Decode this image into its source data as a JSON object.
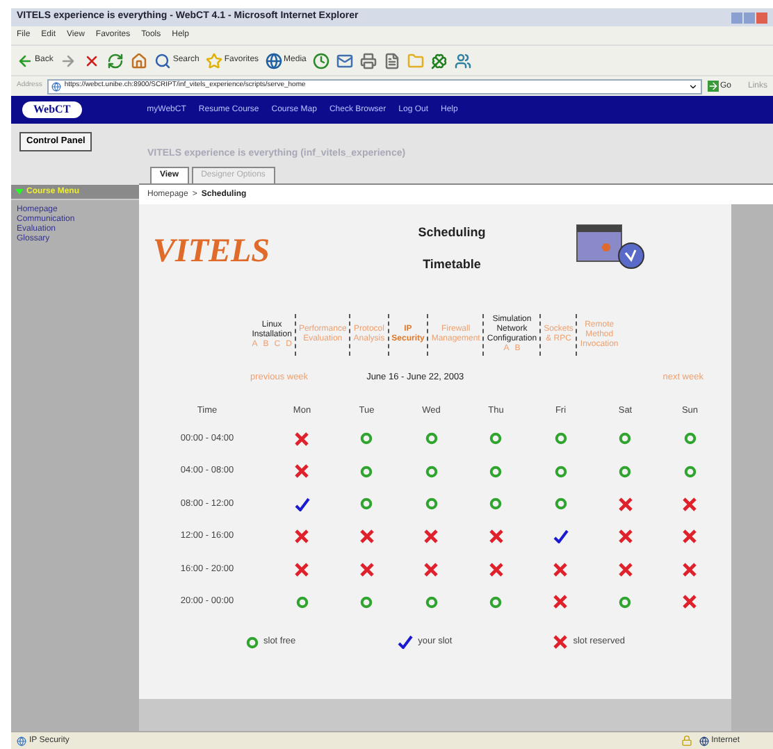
{
  "window": {
    "title": "VITELS experience is everything - WebCT 4.1 - Microsoft Internet Explorer"
  },
  "menu": [
    "File",
    "Edit",
    "View",
    "Favorites",
    "Tools",
    "Help"
  ],
  "toolbar": [
    {
      "kind": "back",
      "label": "Back"
    },
    {
      "kind": "forward"
    },
    {
      "kind": "stop"
    },
    {
      "kind": "refresh"
    },
    {
      "kind": "home"
    },
    {
      "kind": "search",
      "label": "Search"
    },
    {
      "kind": "favorites",
      "label": "Favorites"
    },
    {
      "kind": "media",
      "label": "Media"
    },
    {
      "kind": "history"
    },
    {
      "kind": "mail"
    },
    {
      "kind": "print"
    },
    {
      "kind": "edit"
    },
    {
      "kind": "folder"
    },
    {
      "kind": "clover"
    },
    {
      "kind": "messenger"
    }
  ],
  "address": {
    "label": "Address",
    "url": "https://webct.unibe.ch:8900/SCRIPT/inf_vitels_experience/scripts/serve_home",
    "go": "Go",
    "links": "Links"
  },
  "webct": {
    "logo": "WebCT",
    "links": [
      "myWebCT",
      "Resume Course",
      "Course Map",
      "Check Browser",
      "Log Out",
      "Help"
    ]
  },
  "control_panel": "Control Panel",
  "course_title": "VITELS experience is everything  (inf_vitels_experience)",
  "tabs": [
    {
      "label": "View",
      "selected": true
    },
    {
      "label": "Designer Options",
      "selected": false
    }
  ],
  "sidebar": {
    "heading": "Course Menu",
    "expanded": true,
    "items": [
      "Homepage",
      "Communication",
      "Evaluation",
      "Glossary"
    ]
  },
  "breadcrumb": {
    "parent": "Homepage",
    "separator": ">",
    "current": "Scheduling"
  },
  "logo_text": "VITELS",
  "heading": "Scheduling",
  "subheading": "Timetable",
  "modules": [
    {
      "lines": [
        "Linux",
        "Installation"
      ],
      "kind": "plain",
      "selected": false,
      "parts": [
        "A",
        "B",
        "C",
        "D"
      ]
    },
    {
      "lines": [
        "Performance",
        "Evaluation"
      ],
      "kind": "link",
      "selected": false
    },
    {
      "lines": [
        "Protocol",
        "Analysis"
      ],
      "kind": "link",
      "selected": false
    },
    {
      "lines": [
        "IP",
        "Security"
      ],
      "kind": "link",
      "selected": true
    },
    {
      "lines": [
        "Firewall",
        "Management"
      ],
      "kind": "link",
      "selected": false
    },
    {
      "lines": [
        "Simulation",
        "Network",
        "Configuration"
      ],
      "kind": "plain",
      "selected": false,
      "parts": [
        "A",
        "B"
      ]
    },
    {
      "lines": [
        "Sockets",
        "& RPC"
      ],
      "kind": "link",
      "selected": false
    },
    {
      "lines": [
        "Remote",
        "Method",
        "Invocation"
      ],
      "kind": "link",
      "selected": false
    }
  ],
  "week": {
    "previous": "previous week",
    "range": "June 16 - June 22, 2003",
    "next": "next week"
  },
  "table": {
    "columns": [
      "Time",
      "Mon",
      "Tue",
      "Wed",
      "Thu",
      "Fri",
      "Sat",
      "Sun"
    ],
    "rows": [
      {
        "time": "00:00 - 04:00",
        "slots": [
          {
            "kind": "reserved"
          },
          {
            "kind": "free"
          },
          {
            "kind": "free"
          },
          {
            "kind": "free"
          },
          {
            "kind": "free"
          },
          {
            "kind": "free"
          },
          {
            "kind": "free"
          }
        ]
      },
      {
        "time": "04:00 - 08:00",
        "slots": [
          {
            "kind": "reserved"
          },
          {
            "kind": "free"
          },
          {
            "kind": "free"
          },
          {
            "kind": "free"
          },
          {
            "kind": "free"
          },
          {
            "kind": "free"
          },
          {
            "kind": "free"
          }
        ]
      },
      {
        "time": "08:00 - 12:00",
        "slots": [
          {
            "kind": "mine"
          },
          {
            "kind": "free"
          },
          {
            "kind": "free"
          },
          {
            "kind": "free"
          },
          {
            "kind": "free"
          },
          {
            "kind": "reserved"
          },
          {
            "kind": "reserved"
          }
        ]
      },
      {
        "time": "12:00 - 16:00",
        "slots": [
          {
            "kind": "reserved"
          },
          {
            "kind": "reserved"
          },
          {
            "kind": "reserved"
          },
          {
            "kind": "reserved"
          },
          {
            "kind": "mine"
          },
          {
            "kind": "reserved"
          },
          {
            "kind": "reserved"
          }
        ]
      },
      {
        "time": "16:00 - 20:00",
        "slots": [
          {
            "kind": "reserved"
          },
          {
            "kind": "reserved"
          },
          {
            "kind": "reserved"
          },
          {
            "kind": "reserved"
          },
          {
            "kind": "reserved"
          },
          {
            "kind": "reserved"
          },
          {
            "kind": "reserved"
          }
        ]
      },
      {
        "time": "20:00 - 00:00",
        "slots": [
          {
            "kind": "free"
          },
          {
            "kind": "free"
          },
          {
            "kind": "free"
          },
          {
            "kind": "free"
          },
          {
            "kind": "reserved"
          },
          {
            "kind": "free"
          },
          {
            "kind": "reserved"
          }
        ]
      }
    ]
  },
  "legend": [
    {
      "kind": "free",
      "label": "slot free"
    },
    {
      "kind": "mine",
      "label": "your slot"
    },
    {
      "kind": "reserved",
      "label": "slot reserved"
    }
  ],
  "status_bar": {
    "text": "IP Security",
    "zone": "Internet"
  }
}
